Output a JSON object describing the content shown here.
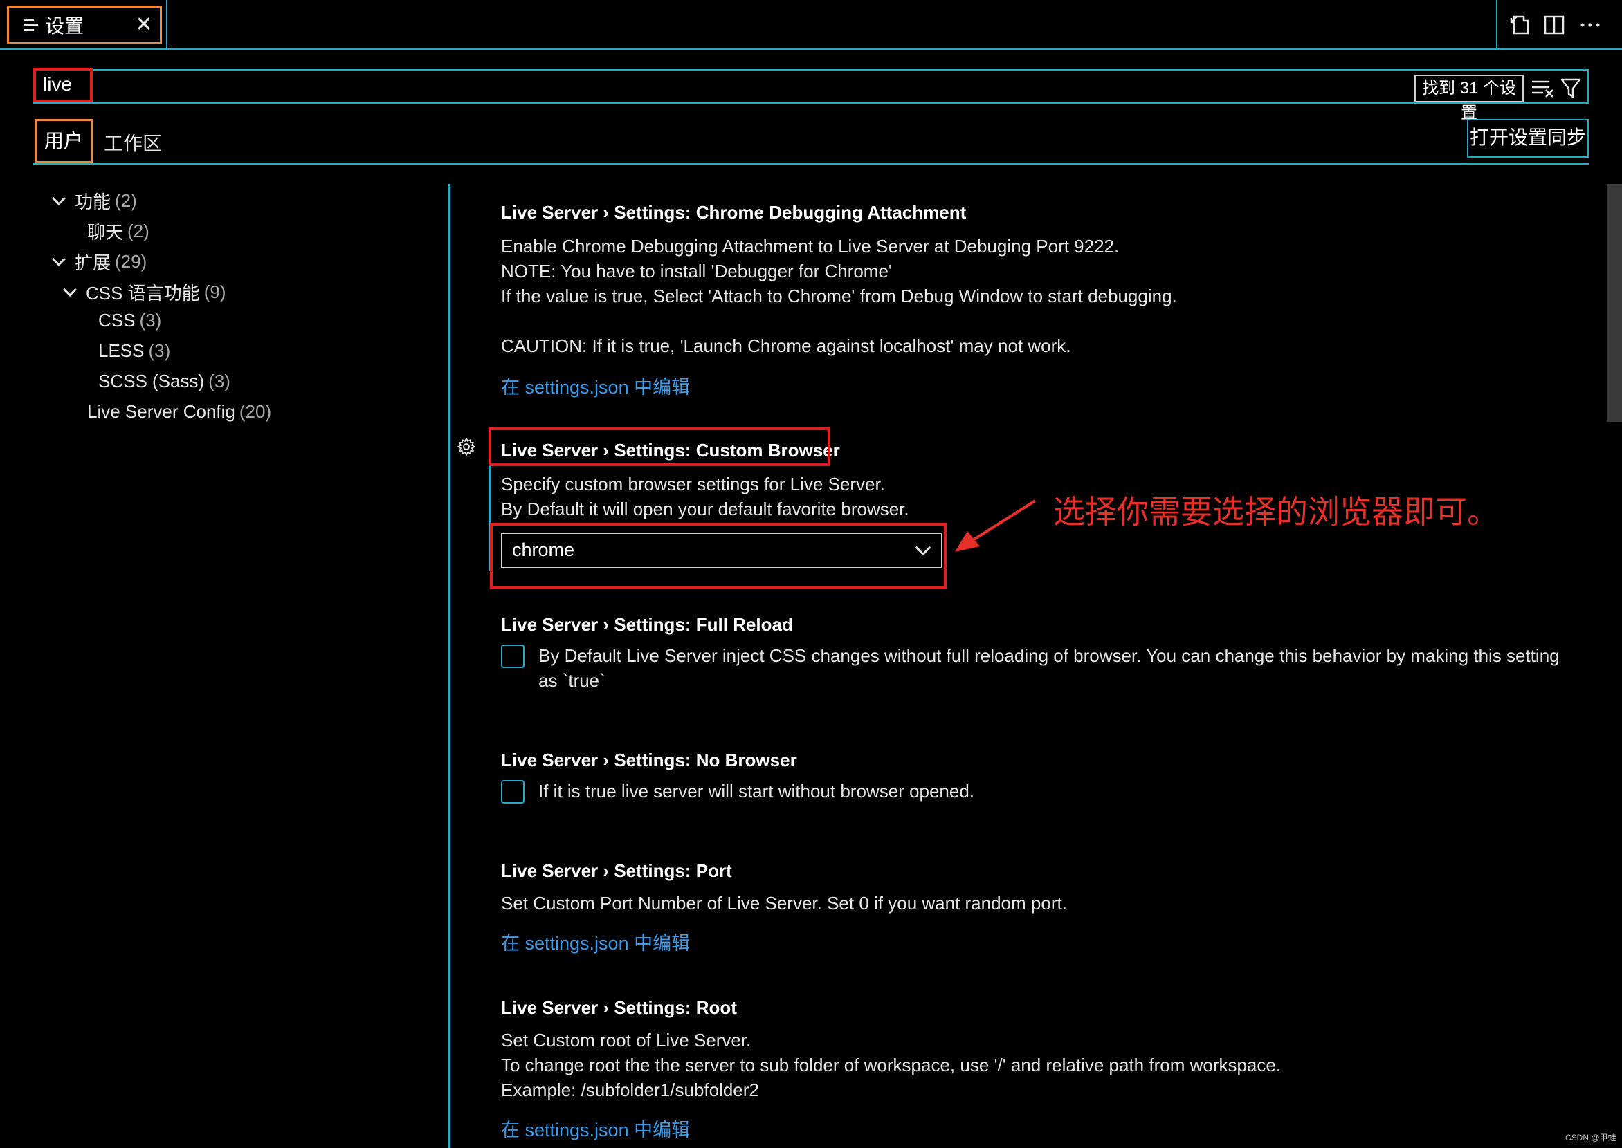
{
  "tab": {
    "label": "设置",
    "close": "✕"
  },
  "search": {
    "value": "live",
    "count": "找到 31 个设置"
  },
  "scope": {
    "user": "用户",
    "workspace": "工作区",
    "sync_button": "打开设置同步"
  },
  "toc": [
    {
      "label": "功能",
      "count": "(2)"
    },
    {
      "label": "聊天",
      "count": "(2)"
    },
    {
      "label": "扩展",
      "count": "(29)"
    },
    {
      "label": "CSS 语言功能",
      "count": "(9)"
    },
    {
      "label": "CSS",
      "count": "(3)"
    },
    {
      "label": "LESS",
      "count": "(3)"
    },
    {
      "label": "SCSS (Sass)",
      "count": "(3)"
    },
    {
      "label": "Live Server Config",
      "count": "(20)"
    }
  ],
  "settings": [
    {
      "category": "Live Server › Settings: ",
      "name": "Chrome Debugging Attachment",
      "desc": [
        "Enable Chrome Debugging Attachment to Live Server at Debuging Port 9222.",
        "NOTE: You have to install 'Debugger for Chrome'",
        "If the value is true, Select 'Attach to Chrome' from Debug Window to start debugging.",
        "CAUTION: If it is true, 'Launch Chrome against localhost' may not work."
      ],
      "link": "在 settings.json 中编辑"
    },
    {
      "category": "Live Server › Settings: ",
      "name": "Custom Browser",
      "desc": [
        "Specify custom browser settings for Live Server.",
        "By Default it will open your default favorite browser."
      ],
      "select_value": "chrome"
    },
    {
      "category": "Live Server › Settings: ",
      "name": "Full Reload",
      "checkbox_text": "By Default Live Server inject CSS changes without full reloading of browser. You can change this behavior by making this setting as `true`"
    },
    {
      "category": "Live Server › Settings: ",
      "name": "No Browser",
      "checkbox_text": "If it is true live server will start without browser opened."
    },
    {
      "category": "Live Server › Settings: ",
      "name": "Port",
      "desc": [
        "Set Custom Port Number of Live Server. Set 0 if you want random port."
      ],
      "link": "在 settings.json 中编辑"
    },
    {
      "category": "Live Server › Settings: ",
      "name": "Root",
      "desc": [
        "Set Custom root of Live Server.",
        "To change root the the server to sub folder of workspace, use '/' and relative path from workspace.",
        "Example: /subfolder1/subfolder2"
      ],
      "link": "在 settings.json 中编辑"
    }
  ],
  "annotation": "选择你需要选择的浏览器即可。",
  "watermark": "CSDN @甲蛙",
  "colors": {
    "accent": "#2aa8c8",
    "highlight_red": "#e02020",
    "tab_orange": "#f08a3a",
    "link": "#3d9be9"
  }
}
